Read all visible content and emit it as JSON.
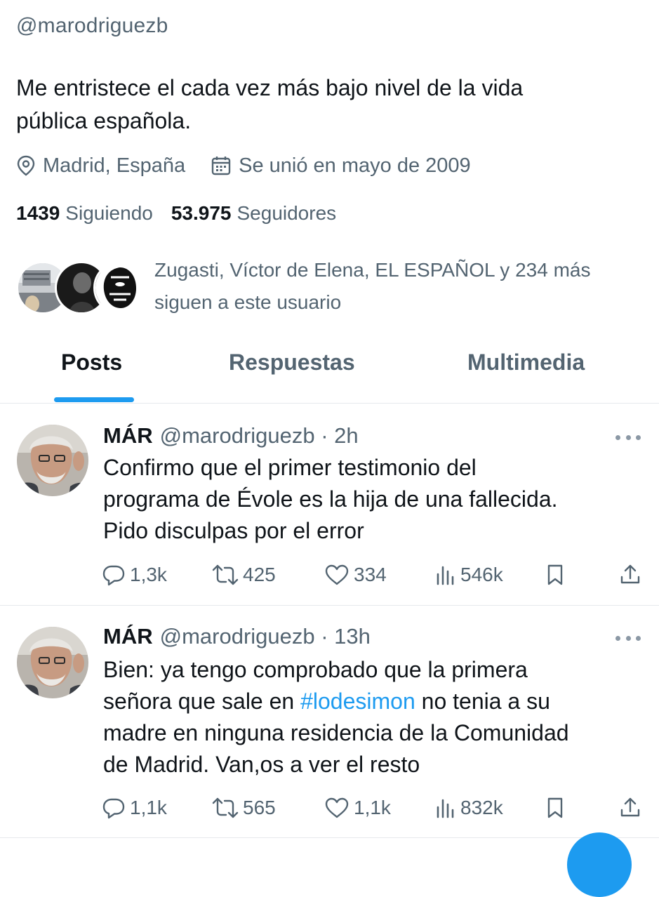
{
  "profile": {
    "handle": "@marodriguezb",
    "bio_line1": "Me entristece el cada vez más bajo nivel de la vida",
    "bio_line2": "pública española.",
    "location": "Madrid, España",
    "joined": "Se unió en mayo de 2009",
    "following_count": "1439",
    "following_label": "Siguiendo",
    "followers_count": "53.975",
    "followers_label": "Seguidores",
    "known_followers_line1": "Zugasti, Víctor de Elena, EL ESPAÑOL y 234 más",
    "known_followers_line2": "siguen a este usuario"
  },
  "tabs": [
    {
      "label": "Posts",
      "active": true
    },
    {
      "label": "Respuestas",
      "active": false
    },
    {
      "label": "Multimedia",
      "active": false
    }
  ],
  "posts": [
    {
      "name": "MÁR",
      "handle": "@marodriguezb",
      "time": "· 2h",
      "lines": [
        "Confirmo que el primer testimonio del",
        "programa de Évole es la hija de una fallecida.",
        "Pido disculpas por el error"
      ],
      "replies": "1,3k",
      "reposts": "425",
      "likes": "334",
      "views": "546k"
    },
    {
      "name": "MÁR",
      "handle": "@marodriguezb",
      "time": "· 13h",
      "line1": "Bien: ya tengo comprobado que la primera",
      "line2_before": "señora que sale en ",
      "hashtag": "#lodesimon",
      "line2_after": " no tenia a su",
      "line3": "madre en ninguna residencia de la Comunidad",
      "line4": "de Madrid. Van,os a ver el resto",
      "replies": "1,1k",
      "reposts": "565",
      "likes": "1,1k",
      "views": "832k"
    }
  ],
  "colors": {
    "accent": "#1d9bf0",
    "text_primary": "#0f1419",
    "text_secondary": "#536471",
    "divider": "#e6e9ec"
  },
  "icons": {
    "location": "map-pin-icon",
    "calendar": "calendar-icon",
    "reply": "reply-icon",
    "repost": "repost-icon",
    "like": "heart-icon",
    "views": "views-icon",
    "bookmark": "bookmark-icon",
    "share": "share-icon",
    "more": "more-icon"
  }
}
